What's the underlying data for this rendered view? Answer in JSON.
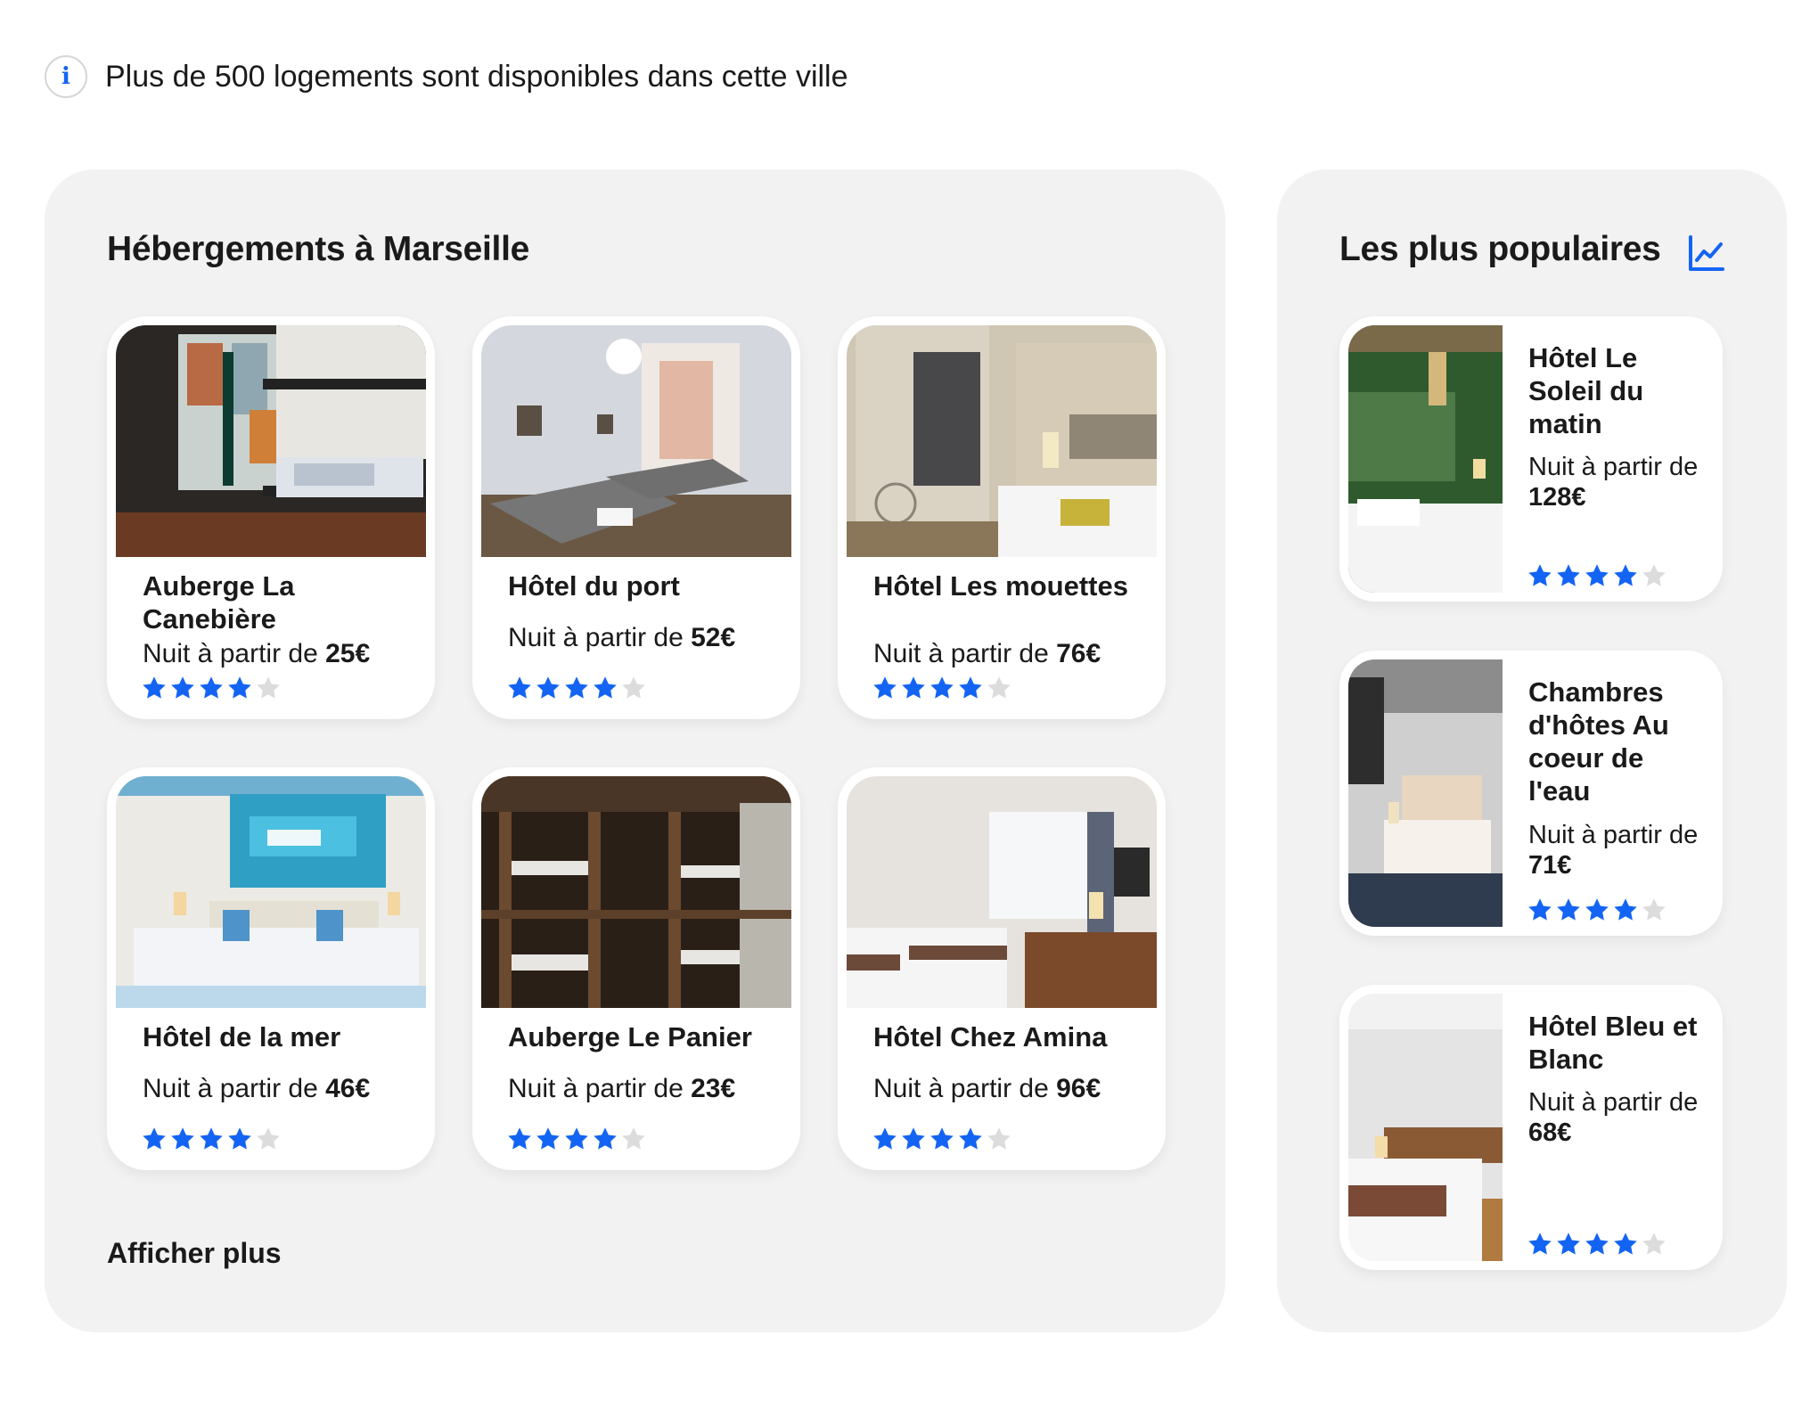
{
  "info": {
    "text": "Plus de 500 logements sont disponibles dans cette ville"
  },
  "main": {
    "title": "Hébergements à Marseille",
    "more_label": "Afficher plus",
    "cards": [
      {
        "name": "Auberge La Canebière",
        "price_prefix": "Nuit à partir de ",
        "price": "25€",
        "rating": 4,
        "max": 5
      },
      {
        "name": "Hôtel du port",
        "price_prefix": "Nuit à partir de ",
        "price": "52€",
        "rating": 4,
        "max": 5
      },
      {
        "name": "Hôtel Les mouettes",
        "price_prefix": "Nuit à partir de ",
        "price": "76€",
        "rating": 4,
        "max": 5
      },
      {
        "name": "Hôtel de la mer",
        "price_prefix": "Nuit à partir de ",
        "price": "46€",
        "rating": 4,
        "max": 5
      },
      {
        "name": "Auberge Le Panier",
        "price_prefix": "Nuit à partir de ",
        "price": "23€",
        "rating": 4,
        "max": 5
      },
      {
        "name": "Hôtel Chez Amina",
        "price_prefix": "Nuit à partir de ",
        "price": "96€",
        "rating": 4,
        "max": 5
      }
    ]
  },
  "side": {
    "title": "Les plus populaires",
    "icon": "trending-chart-icon",
    "items": [
      {
        "name": "Hôtel Le Soleil du matin",
        "price_prefix": "Nuit à partir de ",
        "price": "128€",
        "rating": 4,
        "max": 5
      },
      {
        "name": "Chambres d'hôtes Au coeur de l'eau",
        "price_prefix": "Nuit à partir de ",
        "price": "71€",
        "rating": 4,
        "max": 5
      },
      {
        "name": "Hôtel Bleu et Blanc",
        "price_prefix": "Nuit à partir de ",
        "price": "68€",
        "rating": 4,
        "max": 5
      }
    ]
  },
  "colors": {
    "accent": "#1464f4",
    "panel": "#f2f2f2",
    "star_off": "#dcdcdc"
  }
}
